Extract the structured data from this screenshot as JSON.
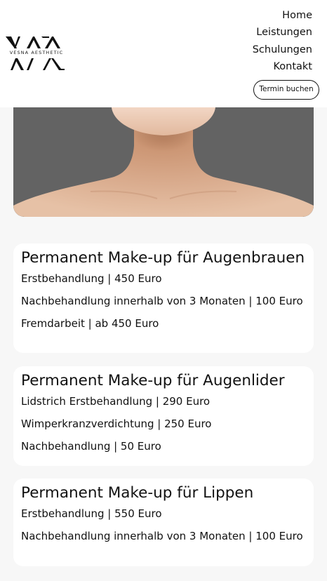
{
  "header": {
    "logo_alt": "VESNA AESTHETIC",
    "nav": [
      "Home",
      "Leistungen",
      "Schulungen",
      "Kontakt"
    ],
    "cta_label": "Termin buchen"
  },
  "hero": {
    "image_desc": "neck-and-shoulders"
  },
  "cards": [
    {
      "title": "Permanent Make-up für Augenbrauen",
      "items": [
        "Erstbehandlung | 450 Euro",
        "Nachbehandlung innerhalb von 3 Monaten | 100 Euro",
        "Fremdarbeit | ab 450 Euro"
      ]
    },
    {
      "title": "Permanent Make-up für Augenlider",
      "items": [
        "Lidstrich Erstbehandlung | 290 Euro",
        "Wimperkranzverdichtung | 250 Euro",
        "Nachbehandlung | 50 Euro"
      ]
    },
    {
      "title": "Permanent Make-up für Lippen",
      "items": [
        "Erstbehandlung | 550 Euro",
        "Nachbehandlung innerhalb von 3 Monaten | 100 Euro"
      ]
    }
  ],
  "colors": {
    "background": "#f7f7f7",
    "card": "#ffffff",
    "text": "#111111",
    "hero_bg": "#636363",
    "skin": "#d9a98c"
  }
}
